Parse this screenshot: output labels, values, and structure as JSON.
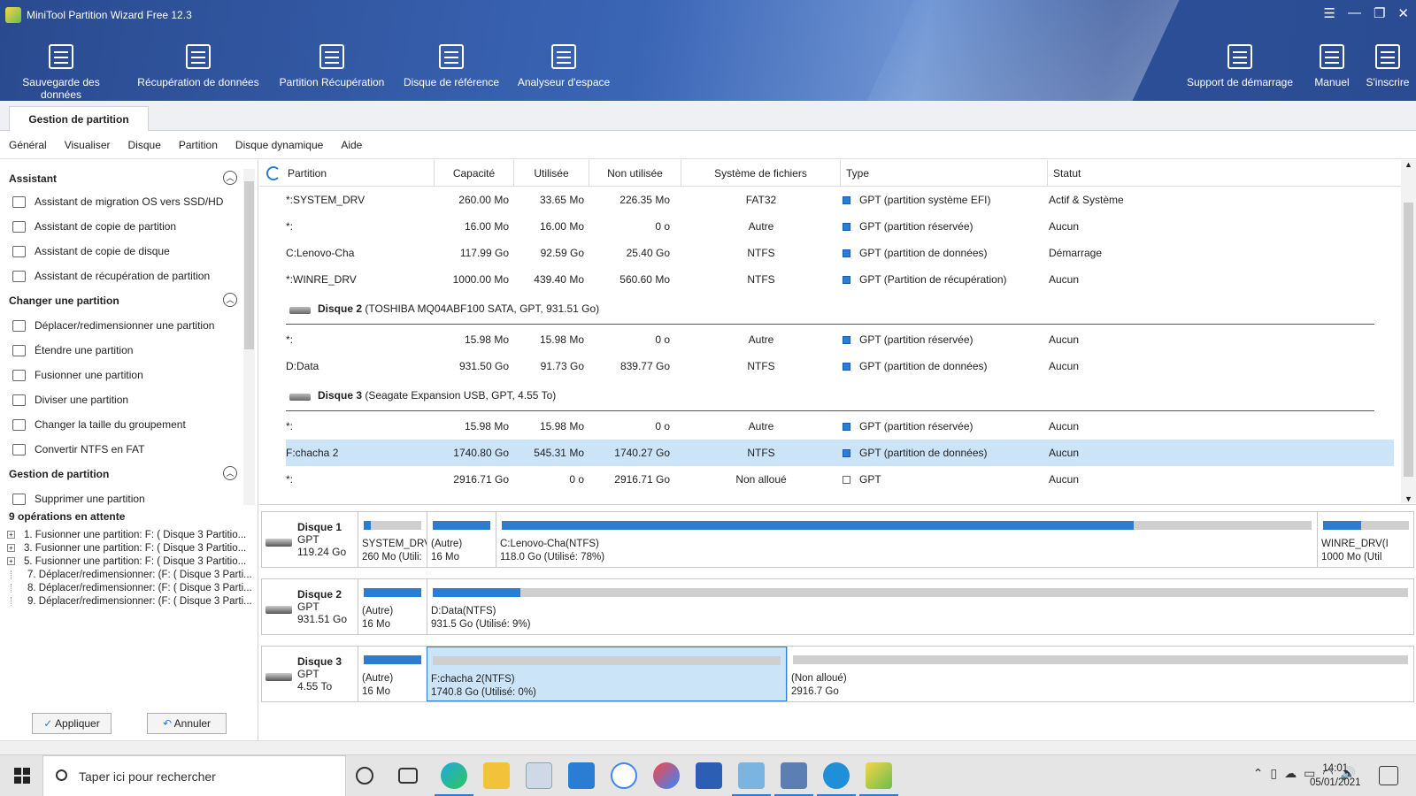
{
  "app": {
    "title": "MiniTool Partition Wizard Free 12.3"
  },
  "toolbar": [
    {
      "label": "Sauvegarde des données",
      "icon": "backup-icon"
    },
    {
      "label": "Récupération de données",
      "icon": "data-recovery-icon"
    },
    {
      "label": "Partition Récupération",
      "icon": "partition-recovery-icon"
    },
    {
      "label": "Disque de référence",
      "icon": "disk-benchmark-icon"
    },
    {
      "label": "Analyseur d'espace",
      "icon": "space-analyzer-icon"
    },
    {
      "label": "Support de démarrage",
      "icon": "bootable-media-icon"
    },
    {
      "label": "Manuel",
      "icon": "manual-icon"
    },
    {
      "label": "S'inscrire",
      "icon": "register-icon"
    }
  ],
  "tabs": {
    "active": "Gestion de partition"
  },
  "menu": [
    "Général",
    "Visualiser",
    "Disque",
    "Partition",
    "Disque dynamique",
    "Aide"
  ],
  "sidebar": {
    "sections": [
      {
        "title": "Assistant",
        "items": [
          "Assistant de migration OS vers SSD/HD",
          "Assistant de copie de partition",
          "Assistant de copie de disque",
          "Assistant de récupération de partition"
        ]
      },
      {
        "title": "Changer une partition",
        "items": [
          "Déplacer/redimensionner une partition",
          "Étendre une partition",
          "Fusionner une partition",
          "Diviser une partition",
          "Changer la taille du groupement",
          "Convertir NTFS en FAT"
        ]
      },
      {
        "title": "Gestion de partition",
        "items": [
          "Supprimer une partition"
        ]
      }
    ],
    "pending_title": "9 opérations en attente",
    "pending": [
      "1. Fusionner une partition: F: ( Disque 3 Partitio...",
      "3. Fusionner une partition: F: ( Disque 3 Partitio...",
      "5. Fusionner une partition: F: ( Disque 3 Partitio...",
      "7. Déplacer/redimensionner: (F: ( Disque 3 Parti...",
      "8. Déplacer/redimensionner: (F: ( Disque 3 Parti...",
      "9. Déplacer/redimensionner: (F: ( Disque 3 Parti..."
    ],
    "apply_label": "Appliquer",
    "undo_label": "Annuler"
  },
  "table": {
    "columns": [
      "Partition",
      "Capacité",
      "Utilisée",
      "Non utilisée",
      "Système de fichiers",
      "Type",
      "Statut"
    ],
    "groups": [
      {
        "header": "",
        "header_detail": "",
        "rows": [
          [
            "*:SYSTEM_DRV",
            "260.00 Mo",
            "33.65 Mo",
            "226.35 Mo",
            "FAT32",
            "GPT (partition système EFI)",
            "Actif & Système"
          ],
          [
            "*:",
            "16.00 Mo",
            "16.00 Mo",
            "0 o",
            "Autre",
            "GPT (partition réservée)",
            "Aucun"
          ],
          [
            "C:Lenovo-Cha",
            "117.99 Go",
            "92.59 Go",
            "25.40 Go",
            "NTFS",
            "GPT (partition de données)",
            "Démarrage"
          ],
          [
            "*:WINRE_DRV",
            "1000.00 Mo",
            "439.40 Mo",
            "560.60 Mo",
            "NTFS",
            "GPT (Partition de récupération)",
            "Aucun"
          ]
        ]
      },
      {
        "header": "Disque 2",
        "header_detail": "(TOSHIBA MQ04ABF100 SATA, GPT, 931.51 Go)",
        "rows": [
          [
            "*:",
            "15.98 Mo",
            "15.98 Mo",
            "0 o",
            "Autre",
            "GPT (partition réservée)",
            "Aucun"
          ],
          [
            "D:Data",
            "931.50 Go",
            "91.73 Go",
            "839.77 Go",
            "NTFS",
            "GPT (partition de données)",
            "Aucun"
          ]
        ]
      },
      {
        "header": "Disque 3",
        "header_detail": "(Seagate Expansion USB, GPT, 4.55 To)",
        "rows": [
          [
            "*:",
            "15.98 Mo",
            "15.98 Mo",
            "0 o",
            "Autre",
            "GPT (partition réservée)",
            "Aucun"
          ],
          [
            "F:chacha 2",
            "1740.80 Go",
            "545.31 Mo",
            "1740.27 Go",
            "NTFS",
            "GPT (partition de données)",
            "Aucun"
          ],
          [
            "*:",
            "2916.71 Go",
            "0 o",
            "2916.71 Go",
            "Non alloué",
            "GPT",
            "Aucun"
          ]
        ]
      }
    ],
    "selected_row": "F:chacha 2"
  },
  "diskmap": [
    {
      "name": "Disque 1",
      "style": "GPT",
      "size": "119.24 Go",
      "partitions": [
        {
          "l1": "SYSTEM_DRV",
          "l2": "260 Mo (Utili:",
          "used": 0.13
        },
        {
          "l1": "(Autre)",
          "l2": "16 Mo",
          "used": 1.0
        },
        {
          "l1": "C:Lenovo-Cha(NTFS)",
          "l2": "118.0 Go (Utilisé: 78%)",
          "used": 0.78
        },
        {
          "l1": "WINRE_DRV(I",
          "l2": "1000 Mo (Util",
          "used": 0.44
        }
      ]
    },
    {
      "name": "Disque 2",
      "style": "GPT",
      "size": "931.51 Go",
      "partitions": [
        {
          "l1": "(Autre)",
          "l2": "16 Mo",
          "used": 1.0
        },
        {
          "l1": "D:Data(NTFS)",
          "l2": "931.5 Go (Utilisé: 9%)",
          "used": 0.09
        }
      ]
    },
    {
      "name": "Disque 3",
      "style": "GPT",
      "size": "4.55 To",
      "partitions": [
        {
          "l1": "(Autre)",
          "l2": "16 Mo",
          "used": 1.0
        },
        {
          "l1": "F:chacha 2(NTFS)",
          "l2": "1740.8 Go (Utilisé: 0%)",
          "used": 0.0
        },
        {
          "l1": "(Non alloué)",
          "l2": "2916.7 Go",
          "used": 0.0
        }
      ]
    }
  ],
  "taskbar": {
    "search_placeholder": "Taper ici pour rechercher",
    "time": "14:01",
    "date": "05/01/2021",
    "tray_icons": [
      "chevron-up-icon",
      "device-icon",
      "cloud-icon",
      "battery-icon",
      "wifi-icon",
      "volume-icon"
    ]
  },
  "colors": {
    "accent": "#2b7cd3",
    "header": "#2a4a8f",
    "selection": "#cce4f7"
  }
}
